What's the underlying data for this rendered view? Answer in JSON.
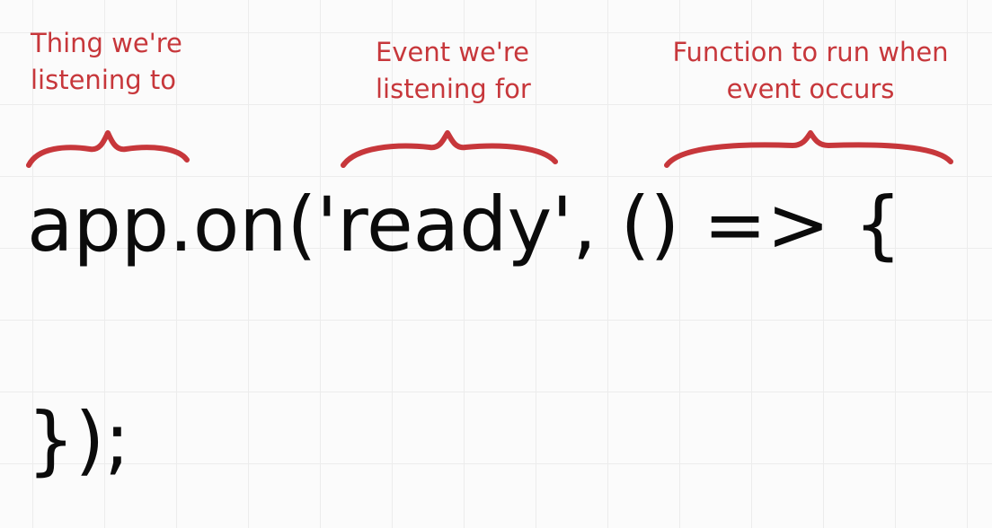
{
  "annotations": [
    {
      "lines": [
        "Thing we're",
        "listening to"
      ]
    },
    {
      "lines": [
        "Event we're",
        "listening for"
      ]
    },
    {
      "lines": [
        "Function to run when",
        "event occurs"
      ]
    }
  ],
  "code": {
    "line1": "app.on('ready', () => {",
    "line2": "});"
  },
  "colors": {
    "annotation": "#c7373b",
    "code": "#0b0b0b",
    "background": "#fbfbfb",
    "grid": "#ececec"
  }
}
